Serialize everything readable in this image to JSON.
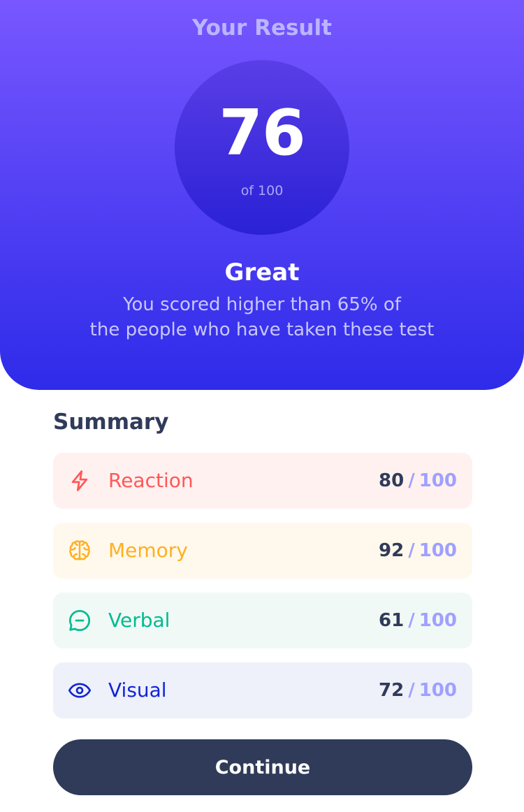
{
  "result": {
    "heading": "Your Result",
    "score": "76",
    "total": "of 100",
    "verdict": "Great",
    "description_line1": "You scored higher than 65% of",
    "description_line2": "the people who have taken these test"
  },
  "summary": {
    "title": "Summary",
    "items": [
      {
        "label": "Reaction",
        "score": "80",
        "max": "100",
        "slash": "/",
        "icon": "lightning-icon",
        "color": "#ff5757",
        "bg": "#fff1f0"
      },
      {
        "label": "Memory",
        "score": "92",
        "max": "100",
        "slash": "/",
        "icon": "brain-icon",
        "color": "#ffb01f",
        "bg": "#fff8ec"
      },
      {
        "label": "Verbal",
        "score": "61",
        "max": "100",
        "slash": "/",
        "icon": "chat-bubble-icon",
        "color": "#00bb8f",
        "bg": "#f0f9f6"
      },
      {
        "label": "Visual",
        "score": "72",
        "max": "100",
        "slash": "/",
        "icon": "eye-icon",
        "color": "#1125d4",
        "bg": "#eef0fa"
      }
    ]
  },
  "continue_label": "Continue",
  "colors": {
    "gradient_top": "#7857ff",
    "gradient_bottom": "#2e2be9",
    "dark_text": "#303b59",
    "max_score": "#9fa0ff"
  }
}
